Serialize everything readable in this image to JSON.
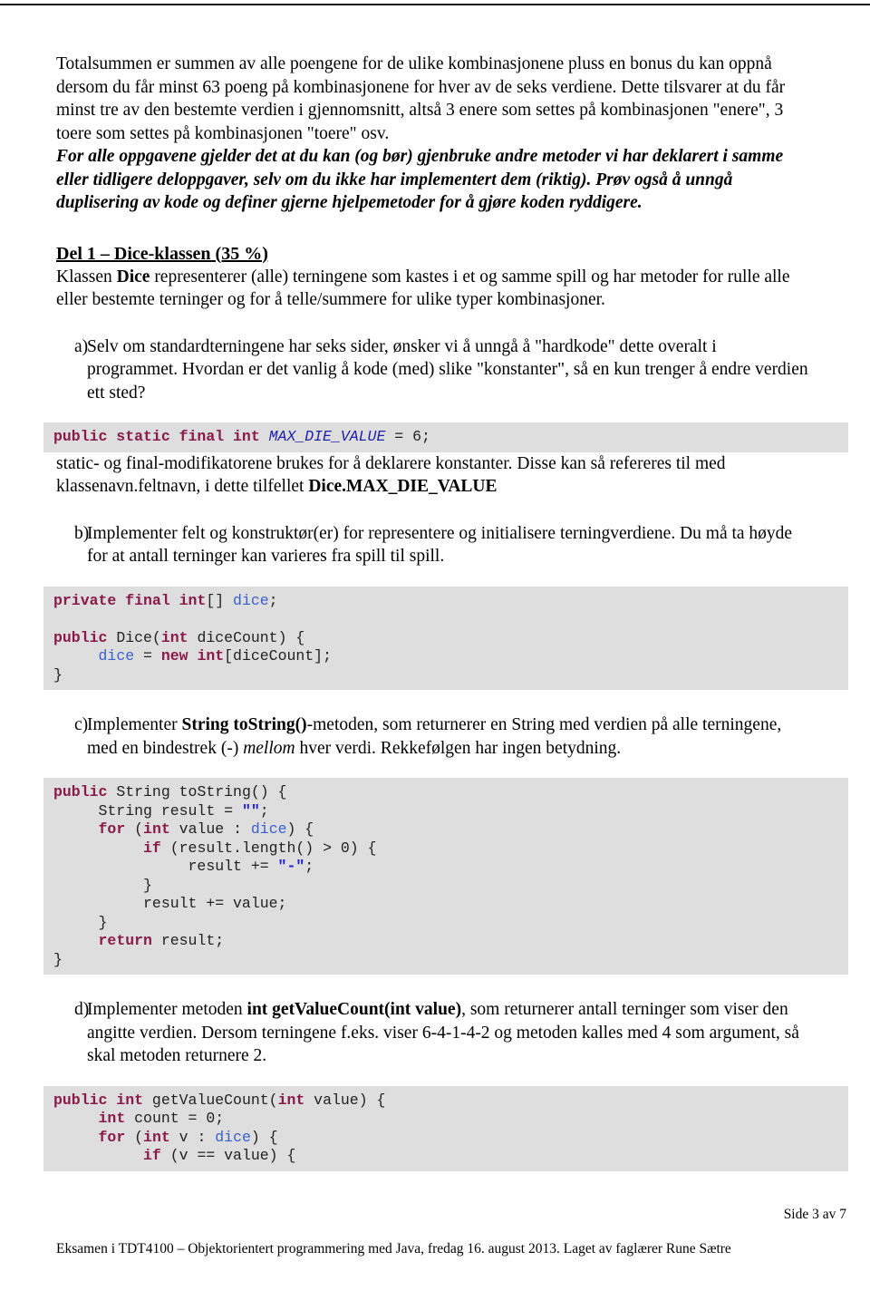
{
  "document": {
    "intro_paragraph": "Totalsummen er summen av alle poengene for de ulike kombinasjonene pluss en bonus du kan oppnå dersom du får minst 63 poeng på kombinasjonene for hver av de seks verdiene. Dette tilsvarer at du får minst tre av den bestemte verdien i gjennomsnitt, altså 3 enere som settes på kombinasjonen \"enere\", 3 toere som settes på kombinasjonen \"toere\" osv.",
    "italic_note": "For alle oppgavene gjelder det at du kan (og bør) gjenbruke andre metoder vi har deklarert i samme eller tidligere deloppgaver, selv om du ikke har implementert dem (riktig). Prøv også å unngå duplisering av kode og definer gjerne hjelpemetoder for å gjøre koden ryddigere.",
    "section_heading": "Del 1 – Dice-klassen (35 %)",
    "class_intro_pre": "Klassen ",
    "class_intro_bold": "Dice",
    "class_intro_post": " representerer (alle) terningene som kastes i et og samme spill og har metoder for rulle alle eller bestemte terninger og for å telle/summere for ulike typer kombinasjoner.",
    "items": {
      "a": {
        "marker": "a)",
        "text": "Selv om standardterningene har seks sider, ønsker vi å unngå å \"hardkode\" dette overalt i programmet. Hvordan er det vanlig å kode (med) slike \"konstanter\", så en kun trenger å endre verdien ett sted?"
      },
      "b": {
        "marker": "b)",
        "text": "Implementer felt og konstruktør(er) for representere og initialisere terningverdiene. Du må ta høyde for at antall terninger kan varieres fra spill til spill."
      },
      "c": {
        "marker": "c)",
        "text_pre": "Implementer ",
        "text_bold": "String toString()",
        "text_mid": "-metoden, som returnerer en String med verdien på alle terningene, med en bindestrek (-) ",
        "text_italic": "mellom",
        "text_post": " hver verdi. Rekkefølgen har ingen betydning."
      },
      "d": {
        "marker": "d)",
        "text_pre": "Implementer metoden ",
        "text_bold": "int getValueCount(int value)",
        "text_post": ", som returnerer antall terninger som viser den angitte verdien. Dersom terningene f.eks. viser 6-4-1-4-2 og metoden kalles med 4 som argument, så skal metoden returnere 2."
      }
    },
    "explanation_pre": "static- og final-modifikatorene brukes for å deklarere konstanter. Disse kan så refereres til med klassenavn.feltnavn, i dette tilfellet ",
    "explanation_bold": "Dice.MAX_DIE_VALUE",
    "code_blocks": {
      "constant": {
        "lines": [
          [
            {
              "t": "public static final int ",
              "c": "kw"
            },
            {
              "t": "MAX_DIE_VALUE",
              "c": "type-const"
            },
            {
              "t": " = 6;",
              "c": ""
            }
          ]
        ]
      },
      "field_constructor": {
        "lines": [
          [
            {
              "t": "private final int",
              "c": "kw"
            },
            {
              "t": "[] ",
              "c": ""
            },
            {
              "t": "dice",
              "c": "field"
            },
            {
              "t": ";",
              "c": ""
            }
          ],
          [
            {
              "t": "",
              "c": ""
            }
          ],
          [
            {
              "t": "public",
              "c": "kw"
            },
            {
              "t": " Dice(",
              "c": ""
            },
            {
              "t": "int",
              "c": "kw"
            },
            {
              "t": " diceCount) {",
              "c": ""
            }
          ],
          [
            {
              "t": "     ",
              "c": ""
            },
            {
              "t": "dice",
              "c": "field"
            },
            {
              "t": " = ",
              "c": ""
            },
            {
              "t": "new int",
              "c": "kw"
            },
            {
              "t": "[diceCount];",
              "c": ""
            }
          ],
          [
            {
              "t": "}",
              "c": ""
            }
          ]
        ]
      },
      "tostring": {
        "lines": [
          [
            {
              "t": "public",
              "c": "kw"
            },
            {
              "t": " String toString() {",
              "c": ""
            }
          ],
          [
            {
              "t": "     String result = ",
              "c": ""
            },
            {
              "t": "\"\"",
              "c": "str"
            },
            {
              "t": ";",
              "c": ""
            }
          ],
          [
            {
              "t": "     ",
              "c": ""
            },
            {
              "t": "for",
              "c": "kw"
            },
            {
              "t": " (",
              "c": ""
            },
            {
              "t": "int",
              "c": "kw"
            },
            {
              "t": " value : ",
              "c": ""
            },
            {
              "t": "dice",
              "c": "field"
            },
            {
              "t": ") {",
              "c": ""
            }
          ],
          [
            {
              "t": "          ",
              "c": ""
            },
            {
              "t": "if",
              "c": "kw"
            },
            {
              "t": " (result.length() > 0) {",
              "c": ""
            }
          ],
          [
            {
              "t": "               result += ",
              "c": ""
            },
            {
              "t": "\"-\"",
              "c": "str"
            },
            {
              "t": ";",
              "c": ""
            }
          ],
          [
            {
              "t": "          }",
              "c": ""
            }
          ],
          [
            {
              "t": "          result += value;",
              "c": ""
            }
          ],
          [
            {
              "t": "     }",
              "c": ""
            }
          ],
          [
            {
              "t": "     ",
              "c": ""
            },
            {
              "t": "return",
              "c": "kw"
            },
            {
              "t": " result;",
              "c": ""
            }
          ],
          [
            {
              "t": "}",
              "c": ""
            }
          ]
        ]
      },
      "getvaluecount": {
        "lines": [
          [
            {
              "t": "public int",
              "c": "kw"
            },
            {
              "t": " getValueCount(",
              "c": ""
            },
            {
              "t": "int",
              "c": "kw"
            },
            {
              "t": " value) {",
              "c": ""
            }
          ],
          [
            {
              "t": "     ",
              "c": ""
            },
            {
              "t": "int",
              "c": "kw"
            },
            {
              "t": " count = 0;",
              "c": ""
            }
          ],
          [
            {
              "t": "     ",
              "c": ""
            },
            {
              "t": "for",
              "c": "kw"
            },
            {
              "t": " (",
              "c": ""
            },
            {
              "t": "int",
              "c": "kw"
            },
            {
              "t": " v : ",
              "c": ""
            },
            {
              "t": "dice",
              "c": "field"
            },
            {
              "t": ") {",
              "c": ""
            }
          ],
          [
            {
              "t": "          ",
              "c": ""
            },
            {
              "t": "if",
              "c": "kw"
            },
            {
              "t": " (v == value) {",
              "c": ""
            }
          ]
        ]
      }
    },
    "footer_text": "Eksamen i TDT4100 – Objektorientert programmering med Java, fredag 16. august 2013. Laget av faglærer Rune Sætre",
    "page_number": "Side 3 av 7"
  },
  "colors": {
    "keyword": "#8b1a4a",
    "constant": "#2020b0",
    "field": "#3a5fd0",
    "string": "#2020cc",
    "code_background": "#dedede",
    "page_background": "#ffffff",
    "text": "#000000"
  }
}
